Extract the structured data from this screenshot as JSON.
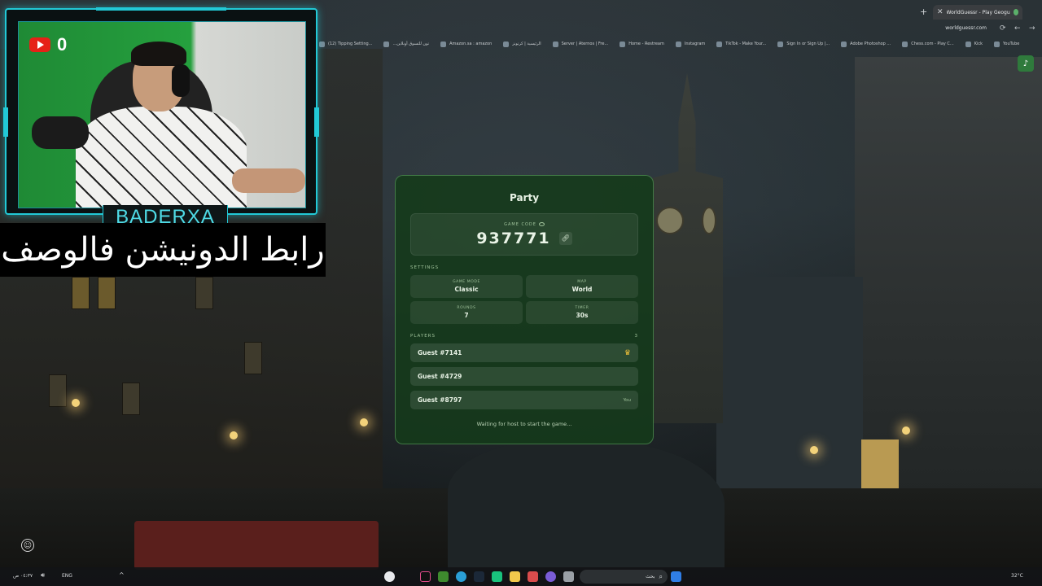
{
  "browser": {
    "tab_title": "WorldGuessr - Play Geoguessr F",
    "new_tab_label": "+",
    "close_label": "✕",
    "url": "worldguessr.com",
    "bookmarks": [
      "(12) Tipping Setting...",
      "...تون للتسوق أونلاين",
      "Amazon.sa : amazon",
      "الرئيسية | كرتونز",
      "Server | Aternos | Fre...",
      "Home - Restream",
      "Instagram",
      "TikTok - Make Your...",
      "Sign In or Sign Up |...",
      "Adobe Photoshop ...",
      "Chess.com - Play C...",
      "Kick",
      "YouTube"
    ]
  },
  "overlay": {
    "youtube_count": "0",
    "streamer_name": "BADERXA",
    "banner_text": "رابط الدونيشن فالوصف"
  },
  "party": {
    "title": "Party",
    "game_code_label": "GAME CODE",
    "game_code": "937771",
    "settings_label": "SETTINGS",
    "settings": [
      {
        "label": "GAME MODE",
        "value": "Classic"
      },
      {
        "label": "MAP",
        "value": "World"
      },
      {
        "label": "ROUNDS",
        "value": "7"
      },
      {
        "label": "TIMER",
        "value": "30s"
      }
    ],
    "players_label": "PLAYERS",
    "players_count": "3",
    "players": [
      {
        "name": "Guest #7141",
        "tag": ""
      },
      {
        "name": "Guest #4729",
        "tag": ""
      },
      {
        "name": "Guest #8797",
        "tag": "You"
      }
    ],
    "waiting_text": "Waiting for host to start the game..."
  },
  "taskbar": {
    "search_label": "بحث",
    "language": "ENG",
    "weather": "32°C",
    "clock_time": "٠٤:٣٧ ص",
    "clock_date": "٢٥/٠٣/٢٠٢٥"
  },
  "colors": {
    "accent_cyan": "#22c9d6",
    "panel_green": "#143a1a",
    "youtube_red": "#e62117",
    "crown_gold": "#f2c23a"
  },
  "icons": [
    "youtube-icon",
    "eye-icon",
    "link-icon",
    "crown-icon",
    "speaker-icon",
    "smiley-icon",
    "search-icon"
  ]
}
